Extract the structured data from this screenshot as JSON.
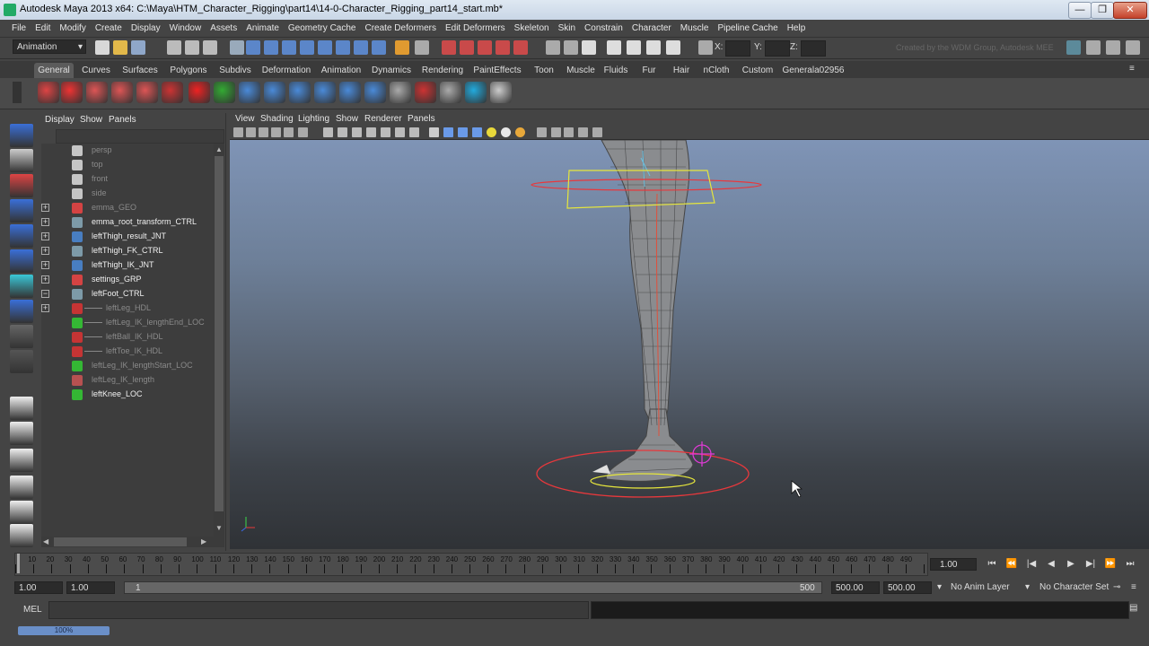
{
  "window": {
    "title": "Autodesk Maya 2013 x64: C:\\Maya\\HTM_Character_Rigging\\part14\\14-0-Character_Rigging_part14_start.mb*",
    "minimize": "—",
    "maximize": "❐",
    "close": "✕"
  },
  "menus": [
    "File",
    "Edit",
    "Modify",
    "Create",
    "Display",
    "Window",
    "Assets",
    "Animate",
    "Geometry Cache",
    "Create Deformers",
    "Edit Deformers",
    "Skeleton",
    "Skin",
    "Constrain",
    "Character",
    "Muscle",
    "Pipeline Cache",
    "Help"
  ],
  "statusline": {
    "mode": "Animation",
    "x_label": "X:",
    "y_label": "Y:",
    "z_label": "Z:",
    "credit": "Created by the WDM Group, Autodesk MEE"
  },
  "shelf_tabs": [
    "General",
    "Curves",
    "Surfaces",
    "Polygons",
    "Subdivs",
    "Deformation",
    "Animation",
    "Dynamics",
    "Rendering",
    "PaintEffects",
    "Toon",
    "Muscle",
    "Fluids",
    "Fur",
    "Hair",
    "nCloth",
    "Custom",
    "Generala02956"
  ],
  "outliner": {
    "menu": [
      "Display",
      "Show",
      "Panels"
    ],
    "rows": [
      {
        "label": "persp",
        "dim": true,
        "exp": "",
        "icon": "camera-icon"
      },
      {
        "label": "top",
        "dim": true,
        "exp": "",
        "icon": "camera-icon"
      },
      {
        "label": "front",
        "dim": true,
        "exp": "",
        "icon": "camera-icon"
      },
      {
        "label": "side",
        "dim": true,
        "exp": "",
        "icon": "camera-icon"
      },
      {
        "label": "emma_GEO",
        "dim": true,
        "exp": "+",
        "icon": "mesh-icon"
      },
      {
        "label": "emma_root_transform_CTRL",
        "dim": false,
        "exp": "+",
        "icon": "curve-icon"
      },
      {
        "label": "leftThigh_result_JNT",
        "dim": false,
        "exp": "+",
        "icon": "joint-icon"
      },
      {
        "label": "leftThigh_FK_CTRL",
        "dim": false,
        "exp": "+",
        "icon": "curve-icon"
      },
      {
        "label": "leftThigh_IK_JNT",
        "dim": false,
        "exp": "+",
        "icon": "joint-icon"
      },
      {
        "label": "settings_GRP",
        "dim": false,
        "exp": "+",
        "icon": "mesh-icon"
      },
      {
        "label": "leftFoot_CTRL",
        "dim": false,
        "exp": "−",
        "icon": "curve-icon"
      },
      {
        "label": "leftLeg_HDL",
        "dim": true,
        "exp": "+",
        "icon": "ik-handle-icon",
        "indent": 1
      },
      {
        "label": "leftLeg_IK_lengthEnd_LOC",
        "dim": true,
        "exp": "",
        "icon": "locator-icon",
        "indent": 1
      },
      {
        "label": "leftBall_IK_HDL",
        "dim": true,
        "exp": "",
        "icon": "ik-handle-icon",
        "indent": 1
      },
      {
        "label": "leftToe_IK_HDL",
        "dim": true,
        "exp": "",
        "icon": "ik-handle-icon",
        "indent": 1
      },
      {
        "label": "leftLeg_IK_lengthStart_LOC",
        "dim": true,
        "exp": "",
        "icon": "locator-icon"
      },
      {
        "label": "leftLeg_IK_length",
        "dim": true,
        "exp": "",
        "icon": "distance-icon"
      },
      {
        "label": "leftKnee_LOC",
        "dim": false,
        "exp": "",
        "icon": "locator-icon"
      }
    ]
  },
  "viewport": {
    "menu": [
      "View",
      "Shading",
      "Lighting",
      "Show",
      "Renderer",
      "Panels"
    ]
  },
  "timeline": {
    "start": 0,
    "end": 500,
    "major_step": 10,
    "current_frame": "1.00"
  },
  "range": {
    "start_time": "1.00",
    "playback_start": "1.00",
    "slider_start": "1",
    "slider_end": "500",
    "playback_end": "500.00",
    "end_time": "500.00",
    "anim_layer": "No Anim Layer",
    "character_set": "No Character Set"
  },
  "cmdline": {
    "label": "MEL"
  },
  "helpline": {
    "progress": "100%",
    "progress_value": 1.0
  }
}
